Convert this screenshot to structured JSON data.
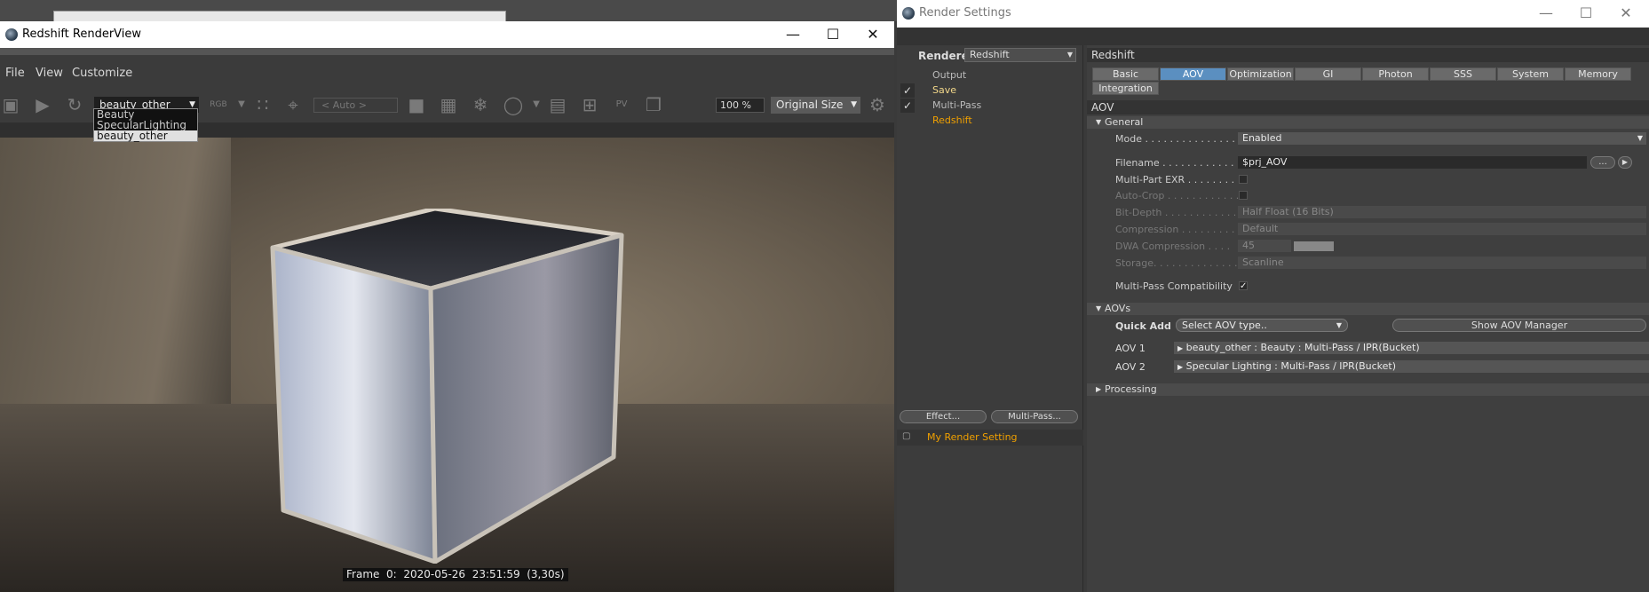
{
  "renderview": {
    "title": "Redshift RenderView",
    "menu": [
      "File",
      "View",
      "Customize"
    ],
    "aov_select": "beauty_other",
    "aov_options": [
      "Beauty",
      "SpecularLighting",
      "beauty_other"
    ],
    "auto_select": "< Auto >",
    "zoom": "100 %",
    "size_select": "Original Size",
    "rgb_label": "RGB",
    "frame_stamp": "Frame  0:  2020-05-26  23:51:59  (3,30s)"
  },
  "render_settings": {
    "title": "Render Settings",
    "renderer_label": "Renderer",
    "renderer_value": "Redshift",
    "tree": [
      "Output",
      "Save",
      "Multi-Pass",
      "Redshift"
    ],
    "effect_button": "Effect...",
    "multipass_button": "Multi-Pass...",
    "setting_name": "My Render Setting",
    "panel_title": "Redshift",
    "tabs": [
      "Basic",
      "AOV",
      "Optimization",
      "GI",
      "Photon",
      "SSS",
      "System",
      "Memory"
    ],
    "tab_integration": "Integration",
    "active_tab": "AOV",
    "aov_header": "AOV",
    "general_section": "General",
    "rows": {
      "mode": {
        "label": "Mode . . . . . . . . . . . . . . .",
        "value": "Enabled"
      },
      "filename": {
        "label": "Filename . . . . . . . . . . . . .",
        "value": "$prj_AOV"
      },
      "multipart": {
        "label": "Multi-Part EXR . . . . . . . ."
      },
      "autocrop": {
        "label": "Auto-Crop . . . . . . . . . . . ."
      },
      "bitdepth": {
        "label": "Bit-Depth . . . . . . . . . . . .",
        "value": "Half Float (16 Bits)"
      },
      "compression": {
        "label": "Compression . . . . . . . . .",
        "value": "Default"
      },
      "dwa": {
        "label": "DWA Compression . . . .",
        "value": "45"
      },
      "storage": {
        "label": "Storage. . . . . . . . . . . . . .",
        "value": "Scanline"
      },
      "mp_compat": {
        "label": "Multi-Pass Compatibility"
      }
    },
    "aovs_section": "AOVs",
    "quick_add_label": "Quick Add",
    "quick_add_placeholder": "Select AOV type..",
    "show_manager_button": "Show AOV Manager",
    "aov_list": [
      {
        "label": "AOV 1",
        "value": "beauty_other : Beauty : Multi-Pass / IPR(Bucket)"
      },
      {
        "label": "AOV 2",
        "value": "Specular Lighting : Multi-Pass / IPR(Bucket)"
      }
    ],
    "processing_section": "Processing"
  },
  "colors": {
    "accent_orange": "#f0a000",
    "active_tab": "#5b8fc0"
  }
}
